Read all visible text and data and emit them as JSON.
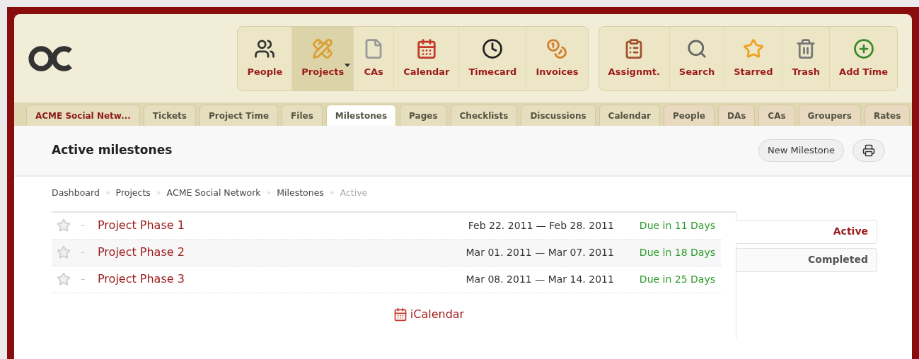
{
  "nav_groups": [
    {
      "items": [
        {
          "label": "People",
          "selected": false,
          "has_menu": false
        },
        {
          "label": "Projects",
          "selected": true,
          "has_menu": true
        },
        {
          "label": "CAs",
          "selected": false,
          "has_menu": false
        },
        {
          "label": "Calendar",
          "selected": false,
          "has_menu": false
        },
        {
          "label": "Timecard",
          "selected": false,
          "has_menu": false
        },
        {
          "label": "Invoices",
          "selected": false,
          "has_menu": false
        }
      ]
    },
    {
      "items": [
        {
          "label": "Assignmt.",
          "selected": false,
          "has_menu": false
        },
        {
          "label": "Search",
          "selected": false,
          "has_menu": false
        },
        {
          "label": "Starred",
          "selected": false,
          "has_menu": false
        },
        {
          "label": "Trash",
          "selected": false,
          "has_menu": false
        },
        {
          "label": "Add Time",
          "selected": false,
          "has_menu": false
        }
      ]
    }
  ],
  "tabs": [
    {
      "label": "ACME Social Netw...",
      "kind": "title",
      "selected": false
    },
    {
      "label": "Tickets",
      "kind": "project",
      "selected": false
    },
    {
      "label": "Project Time",
      "kind": "project",
      "selected": false
    },
    {
      "label": "Files",
      "kind": "project",
      "selected": false
    },
    {
      "label": "Milestones",
      "kind": "project",
      "selected": true
    },
    {
      "label": "Pages",
      "kind": "project",
      "selected": false
    },
    {
      "label": "Checklists",
      "kind": "project",
      "selected": false
    },
    {
      "label": "Discussions",
      "kind": "project",
      "selected": false
    },
    {
      "label": "Calendar",
      "kind": "project",
      "selected": false
    },
    {
      "label": "People",
      "kind": "company",
      "selected": false
    },
    {
      "label": "DAs",
      "kind": "company",
      "selected": false
    },
    {
      "label": "CAs",
      "kind": "company",
      "selected": false
    },
    {
      "label": "Groupers",
      "kind": "company",
      "selected": false
    },
    {
      "label": "Rates",
      "kind": "company",
      "selected": false
    }
  ],
  "page": {
    "title": "Active milestones",
    "new_button": "New Milestone"
  },
  "breadcrumb": [
    {
      "label": "Dashboard",
      "current": false
    },
    {
      "label": "Projects",
      "current": false
    },
    {
      "label": "ACME Social Network",
      "current": false
    },
    {
      "label": "Milestones",
      "current": false
    },
    {
      "label": "Active",
      "current": true
    }
  ],
  "breadcrumb_separator": "»",
  "milestones": [
    {
      "starred": false,
      "marker": "–",
      "title": "Project Phase 1",
      "dates": "Feb 22. 2011 — Feb 28. 2011",
      "due": "Due in 11 Days"
    },
    {
      "starred": false,
      "marker": "–",
      "title": "Project Phase 2",
      "dates": "Mar 01. 2011 — Mar 07. 2011",
      "due": "Due in 18 Days"
    },
    {
      "starred": false,
      "marker": "–",
      "title": "Project Phase 3",
      "dates": "Mar 08. 2011 — Mar 14. 2011",
      "due": "Due in 25 Days"
    }
  ],
  "icalendar_link": "iCalendar",
  "filters": [
    {
      "label": "Active",
      "selected": true
    },
    {
      "label": "Completed",
      "selected": false
    }
  ]
}
